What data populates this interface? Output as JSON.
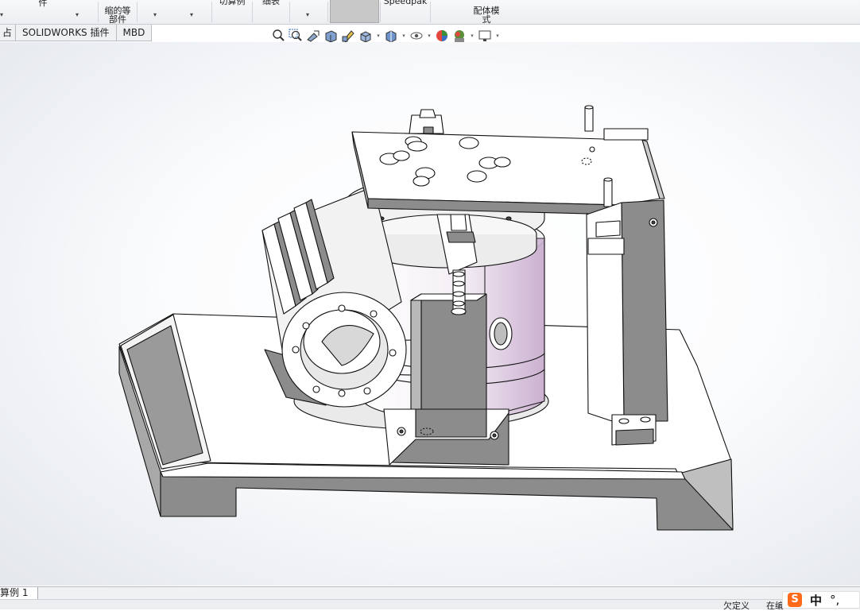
{
  "ribbon": {
    "items": [
      {
        "label": "件"
      },
      {
        "label": "缩的等\n部件"
      },
      {
        "label": "切算例"
      },
      {
        "label": "细表"
      },
      {
        "label": "Speedpak"
      },
      {
        "label": "配体模\n式"
      }
    ]
  },
  "tabs": [
    {
      "label": "占"
    },
    {
      "label": "SOLIDWORKS 插件"
    },
    {
      "label": "MBD"
    }
  ],
  "hud_icons": [
    "zoom-to-fit-icon",
    "zoom-to-area-icon",
    "previous-view-icon",
    "section-view-icon",
    "dynamic-annotation-icon",
    "view-orientation-icon",
    "display-style-icon",
    "hide-show-items-icon",
    "edit-appearance-icon",
    "apply-scene-icon",
    "view-settings-icon"
  ],
  "bottom": {
    "study_tab": "算例 1"
  },
  "status": {
    "left": "欠定义",
    "right": "在编"
  },
  "ime": {
    "logo": "S",
    "mode": "中",
    "punct": "°,"
  },
  "colors": {
    "accent": "#ff6a1a",
    "model_body": "#ffffff",
    "model_shadow": "#8c8c8c",
    "model_mauve": "#d9c6dc"
  }
}
